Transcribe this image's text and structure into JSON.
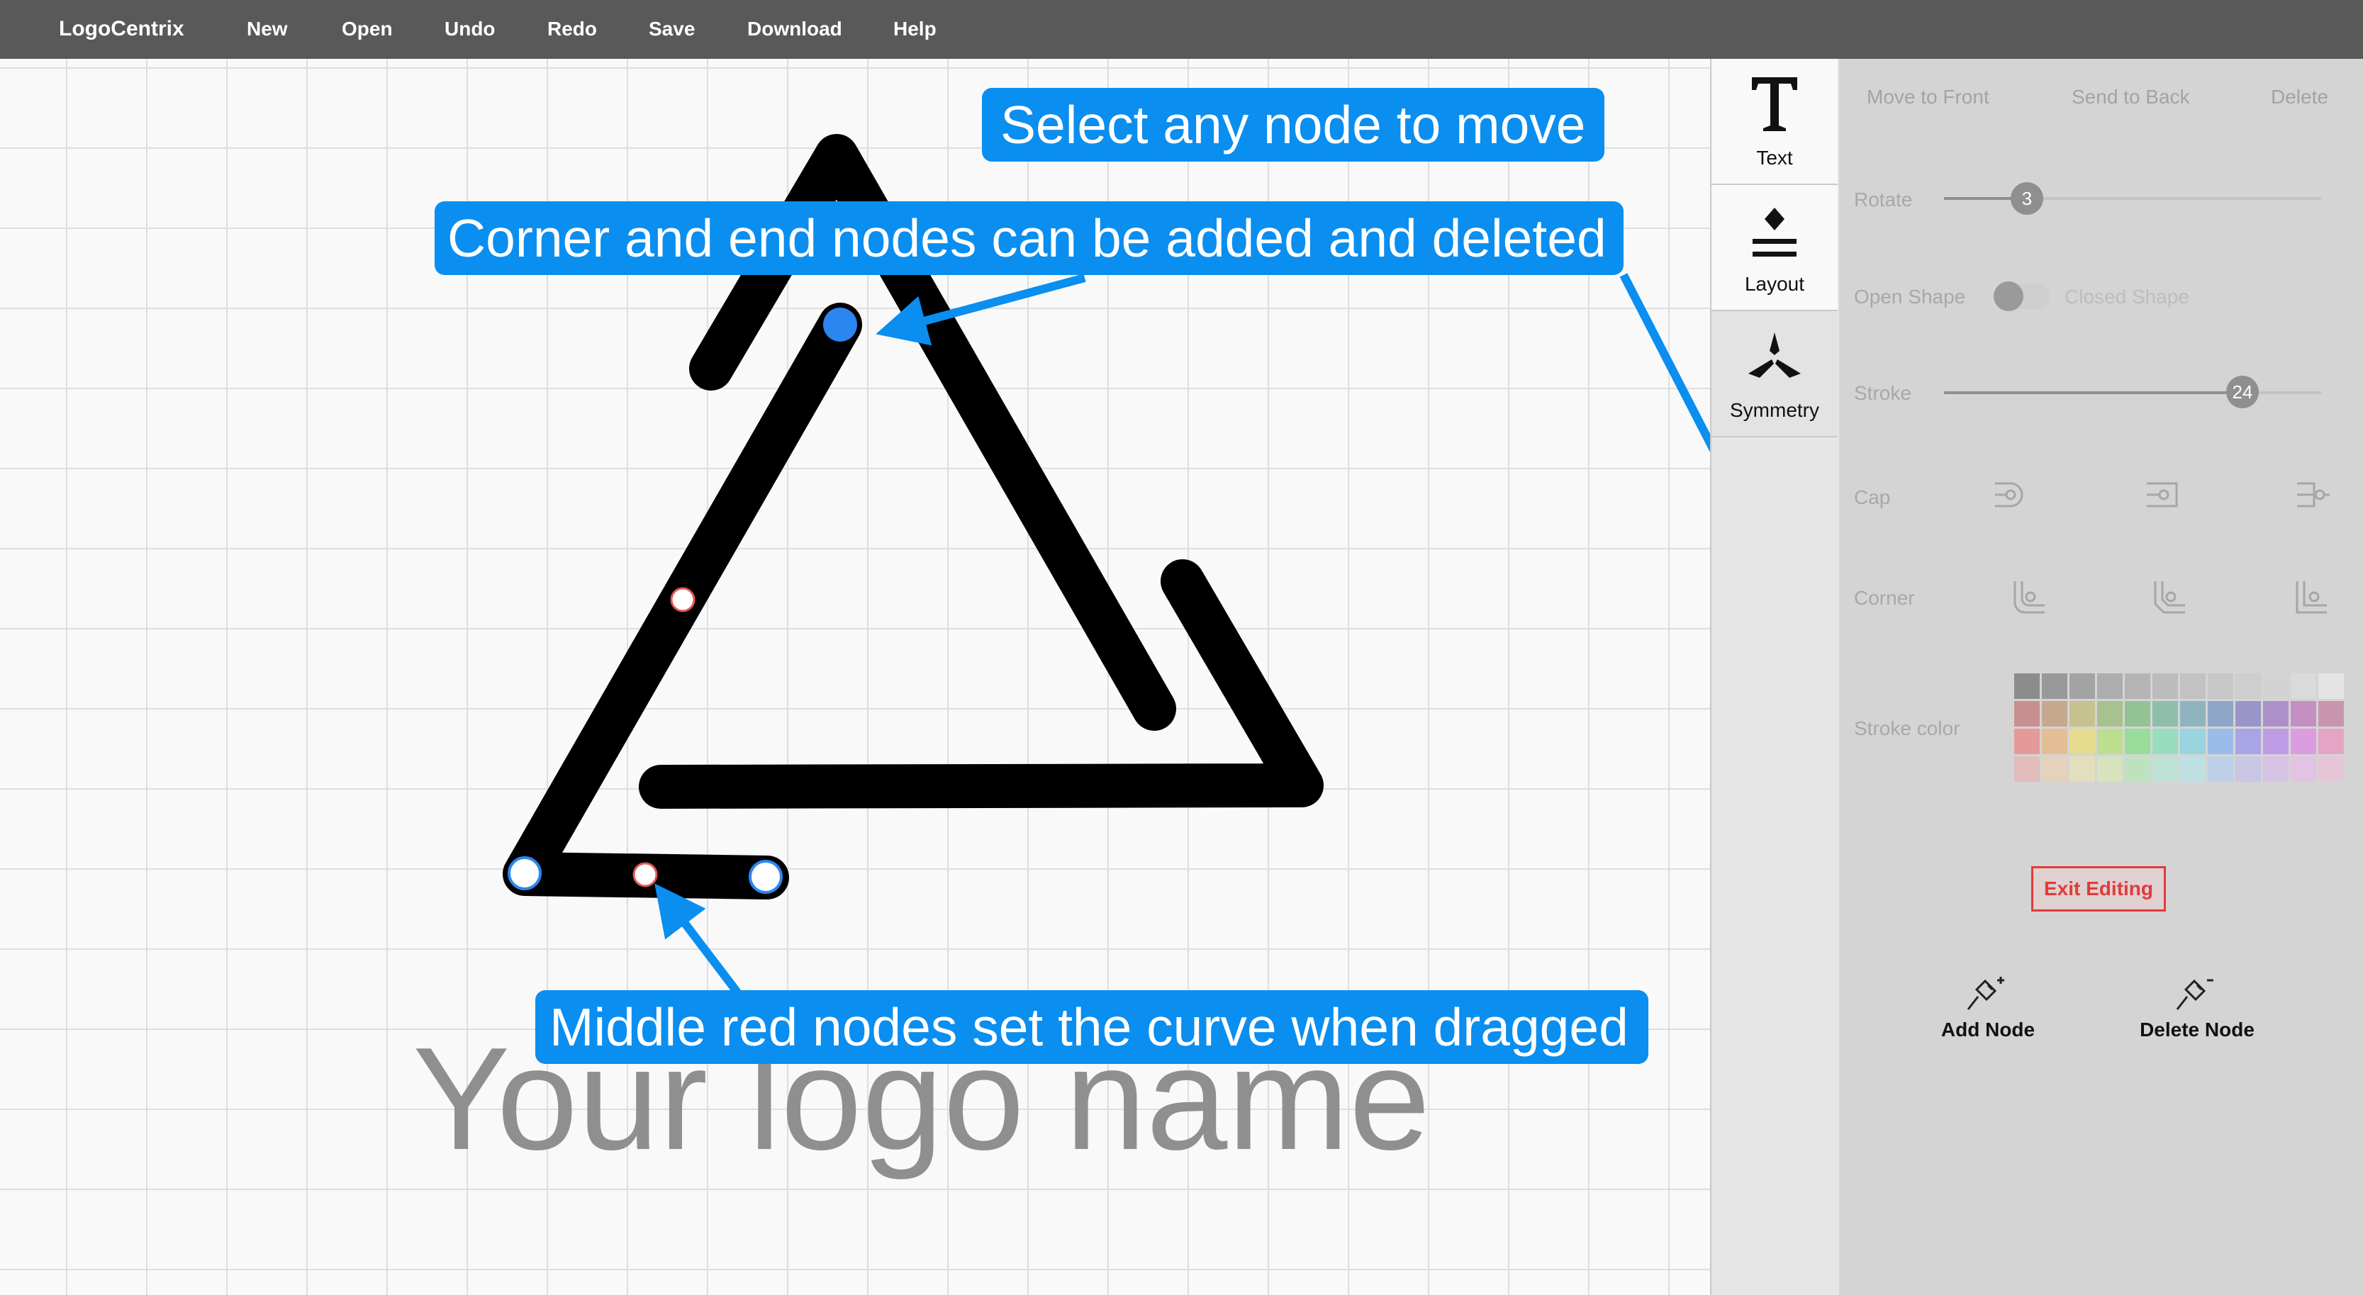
{
  "menubar": {
    "brand": "LogoCentrix",
    "items": [
      "New",
      "Open",
      "Undo",
      "Redo",
      "Save",
      "Download",
      "Help"
    ]
  },
  "canvas": {
    "logo_text": "Your logo name"
  },
  "callouts": {
    "select": "Select  any node to move",
    "corner": "Corner and end nodes can be added and deleted",
    "middle": "Middle red nodes set the curve when dragged"
  },
  "toolbar": {
    "text": "Text",
    "layout": "Layout",
    "symmetry": "Symmetry"
  },
  "panel": {
    "move_to_front": "Move to Front",
    "send_to_back": "Send to Back",
    "delete": "Delete",
    "rotate_label": "Rotate",
    "rotate_value": "3",
    "open_shape": "Open Shape",
    "closed_shape": "Closed Shape",
    "stroke_label": "Stroke",
    "stroke_value": "24",
    "cap_label": "Cap",
    "corner_label": "Corner",
    "stroke_color_label": "Stroke color",
    "exit_editing": "Exit Editing",
    "add_node": "Add Node",
    "delete_node": "Delete Node"
  },
  "colors": {
    "accent": "#0a8ef0",
    "danger": "#e23b3b",
    "selected_node": "#2b86f0",
    "curve_node": "#e05555"
  },
  "palette_colors": [
    "#8c8c8c",
    "#999999",
    "#a3a3a3",
    "#adadad",
    "#b4b4b4",
    "#bcbcbc",
    "#c2c2c2",
    "#c8c8c8",
    "#cecece",
    "#d3d3d3",
    "#dadada",
    "#e4e4e4",
    "#c98f8f",
    "#c6a88f",
    "#c6c28f",
    "#a8c28f",
    "#93c295",
    "#8fbfaa",
    "#8fb4bf",
    "#8fa6c9",
    "#9a95c9",
    "#ad90c9",
    "#c490c4",
    "#c995ac",
    "#e59a9a",
    "#e4be96",
    "#e4dc8c",
    "#bcdf8f",
    "#99dc99",
    "#99dcc0",
    "#99d4e0",
    "#99bde8",
    "#a9a4e6",
    "#c09ce6",
    "#dc9ce0",
    "#e6a4c4",
    "#e3bcbc",
    "#e3d2bc",
    "#e3dfbc",
    "#d6e3bc",
    "#bde3be",
    "#bde3d6",
    "#bde0e3",
    "#bdd0e8",
    "#c9c6e6",
    "#d6c3e6",
    "#e3c3e3",
    "#e6c6d6"
  ]
}
